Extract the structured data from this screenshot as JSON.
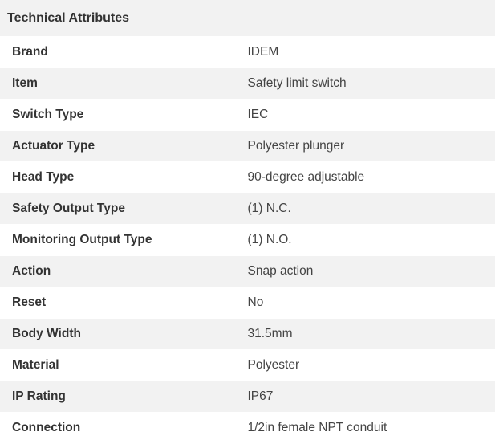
{
  "header": {
    "title": "Technical Attributes"
  },
  "attributes": [
    {
      "name": "Brand",
      "value": "IDEM"
    },
    {
      "name": "Item",
      "value": "Safety limit switch"
    },
    {
      "name": "Switch Type",
      "value": "IEC"
    },
    {
      "name": "Actuator Type",
      "value": "Polyester plunger"
    },
    {
      "name": "Head Type",
      "value": "90-degree adjustable"
    },
    {
      "name": "Safety Output Type",
      "value": "(1) N.C."
    },
    {
      "name": "Monitoring Output Type",
      "value": "(1) N.O."
    },
    {
      "name": "Action",
      "value": "Snap action"
    },
    {
      "name": "Reset",
      "value": "No"
    },
    {
      "name": "Body Width",
      "value": "31.5mm"
    },
    {
      "name": "Material",
      "value": "Polyester"
    },
    {
      "name": "IP Rating",
      "value": "IP67"
    },
    {
      "name": "Connection",
      "value": "1/2in female NPT conduit"
    }
  ],
  "colors": {
    "header_bg": "#f2f2f2",
    "stripe_bg": "#f2f2f2",
    "row_bg": "#ffffff",
    "text": "#333333"
  }
}
